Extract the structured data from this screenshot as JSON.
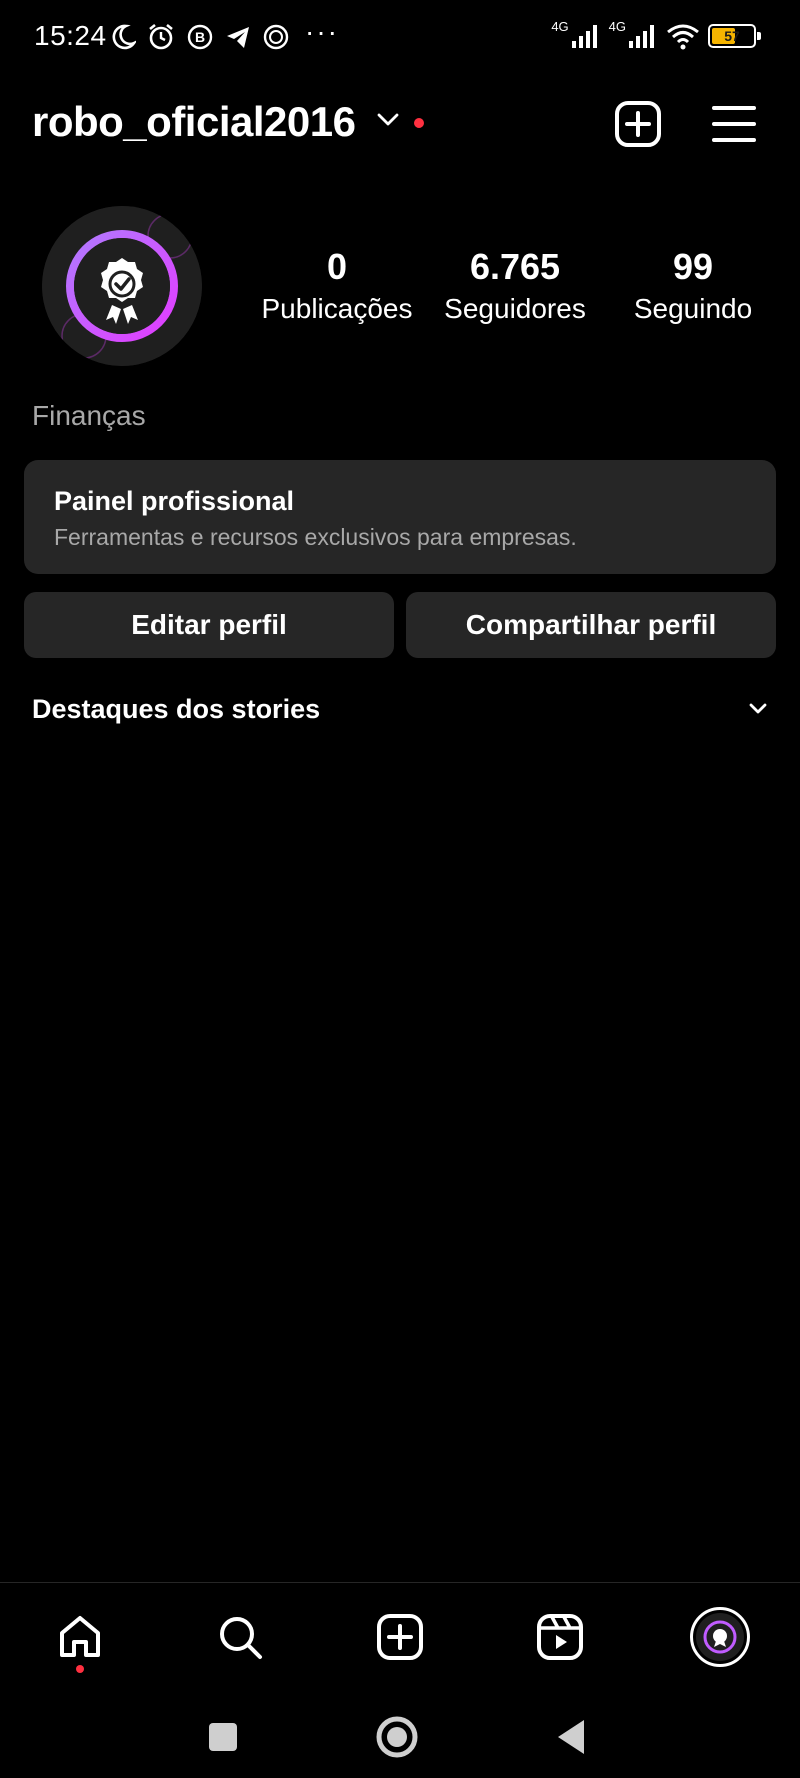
{
  "status_bar": {
    "time": "15:24",
    "network_1": "4G",
    "network_2": "4G",
    "battery_level": "57",
    "more_indicator": "···",
    "icons": [
      "moon-icon",
      "alarm-icon",
      "b-app-icon",
      "telegram-icon",
      "b-circle-icon",
      "signal-icon",
      "wifi-icon",
      "battery-icon"
    ],
    "battery_color": "#f5b400"
  },
  "header": {
    "username": "robo_oficial2016",
    "icons": [
      "chevron-down-icon",
      "create-icon",
      "menu-icon"
    ],
    "notification_dot_color": "#ff3040"
  },
  "profile": {
    "stats": [
      {
        "value": "0",
        "label": "Publicações"
      },
      {
        "value": "6.765",
        "label": "Seguidores"
      },
      {
        "value": "99",
        "label": "Seguindo"
      }
    ],
    "category": "Finanças",
    "avatar_ring_colors": [
      "#d33bff",
      "#a56bff"
    ]
  },
  "pro_dashboard": {
    "title": "Painel profissional",
    "subtitle": "Ferramentas e recursos exclusivos para empresas."
  },
  "actions": {
    "edit_label": "Editar perfil",
    "share_label": "Compartilhar perfil"
  },
  "highlights": {
    "title": "Destaques dos stories"
  },
  "bottom_nav": {
    "items": [
      "home-icon",
      "search-icon",
      "create-icon",
      "reels-icon",
      "profile-avatar"
    ]
  },
  "system_nav": {
    "items": [
      "recents-button",
      "home-button",
      "back-button"
    ]
  }
}
